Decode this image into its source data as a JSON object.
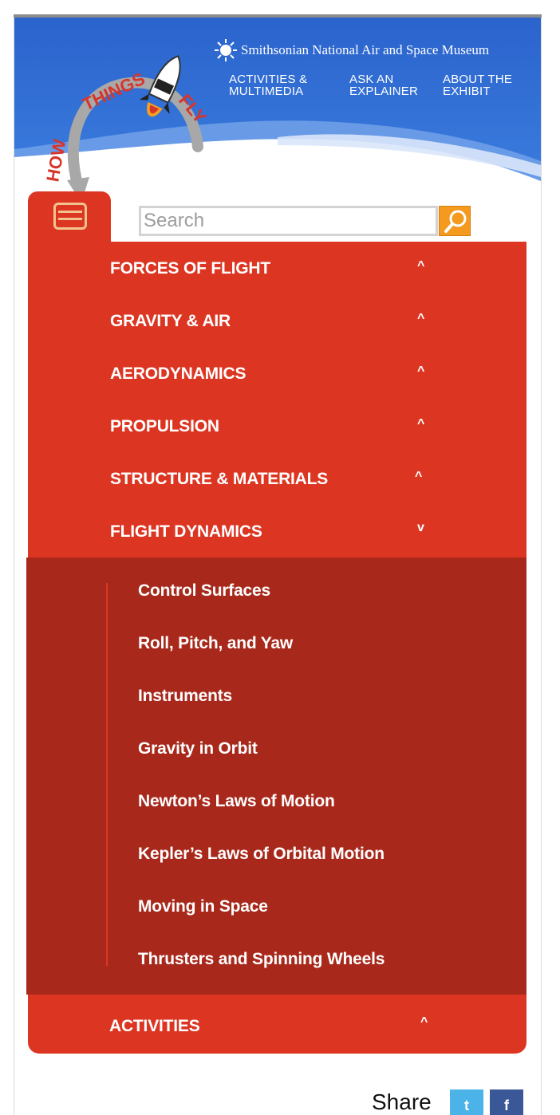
{
  "header": {
    "logo_text": "HOW THINGS FLY",
    "museum_name": "Smithsonian National Air and Space Museum",
    "nav": [
      {
        "line1": "ACTIVITIES &",
        "line2": "MULTIMEDIA"
      },
      {
        "line1": "ASK AN",
        "line2": "EXPLAINER"
      },
      {
        "line1": "ABOUT THE",
        "line2": "EXHIBIT"
      }
    ]
  },
  "search": {
    "placeholder": "Search"
  },
  "menu": {
    "items": [
      {
        "label": "FORCES OF FLIGHT",
        "chevron": "^"
      },
      {
        "label": "GRAVITY & AIR",
        "chevron": "^"
      },
      {
        "label": "AERODYNAMICS",
        "chevron": "^"
      },
      {
        "label": "PROPULSION",
        "chevron": "^"
      },
      {
        "label": "STRUCTURE & MATERIALS",
        "chevron": "^"
      },
      {
        "label": "FLIGHT DYNAMICS",
        "chevron": "v"
      }
    ],
    "submenu": [
      "Control Surfaces",
      "Roll, Pitch, and Yaw",
      "Instruments",
      "Gravity in Orbit",
      "Newton’s Laws of Motion",
      "Kepler’s Laws of Orbital Motion",
      "Moving in Space",
      "Thrusters and Spinning Wheels"
    ],
    "activities": {
      "label": "ACTIVITIES",
      "chevron": "^"
    }
  },
  "share": {
    "label": "Share",
    "twitter_glyph": "t",
    "facebook_glyph": "f"
  },
  "colors": {
    "menu_red": "#dc3623",
    "submenu_red": "#a8291c",
    "sky_blue": "#2f6fd2",
    "search_orange": "#f39a1f"
  }
}
